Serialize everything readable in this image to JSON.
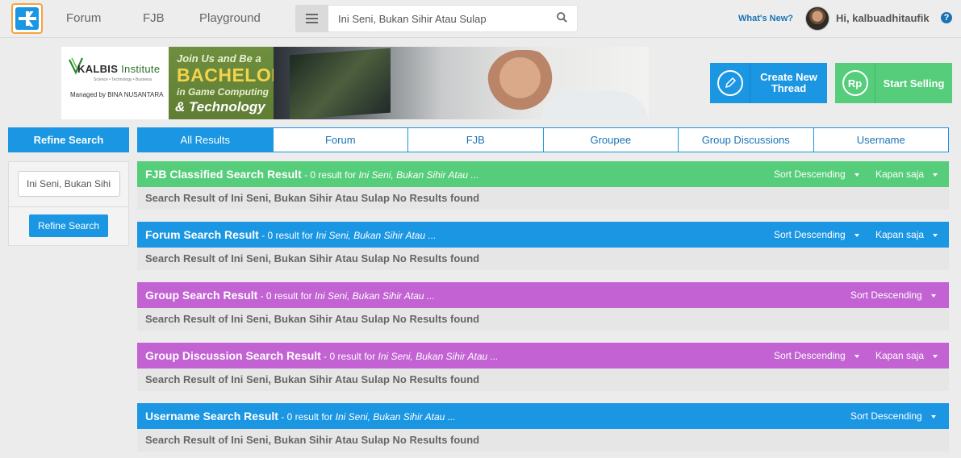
{
  "nav": {
    "links": [
      "Forum",
      "FJB",
      "Playground"
    ],
    "search_value": "Ini Seni, Bukan Sihir Atau Sulap",
    "whats_new": "What's New?",
    "greeting": "Hi, kalbuadhitaufik",
    "help": "?"
  },
  "banner": {
    "brand": "KALBIS",
    "brand_suffix": "Institute",
    "tagline": "Science • Technology • Business",
    "managed_by": "Managed by BINA NUSANTARA",
    "line1": "Join Us and Be a",
    "line2": "BACHELOR",
    "line3": "in Game Computing",
    "line4": "& Technology"
  },
  "actions": {
    "create_thread": "Create New Thread",
    "start_selling": "Start Selling",
    "rp_icon": "Rp"
  },
  "sidebar": {
    "header": "Refine Search",
    "input_value": "Ini Seni, Bukan Sihir Atau Sulap",
    "button": "Refine Search"
  },
  "tabs": [
    "All Results",
    "Forum",
    "FJB",
    "Groupee",
    "Group Discussions",
    "Username"
  ],
  "sections": [
    {
      "title": "FJB Classified Search Result",
      "count": " - 0 result for ",
      "query": "Ini Seni, Bukan Sihir Atau ...",
      "sort": "Sort Descending",
      "time": "Kapan saja",
      "body": "Search Result of Ini Seni, Bukan Sihir Atau Sulap No Results found",
      "color": "#55cd7a"
    },
    {
      "title": "Forum Search Result",
      "count": " - 0 result for ",
      "query": "Ini Seni, Bukan Sihir Atau ...",
      "sort": "Sort Descending",
      "time": "Kapan saja",
      "body": "Search Result of Ini Seni, Bukan Sihir Atau Sulap No Results found",
      "color": "#1a96e3"
    },
    {
      "title": "Group Search Result",
      "count": " - 0 result for ",
      "query": "Ini Seni, Bukan Sihir Atau ...",
      "sort": "Sort Descending",
      "body": "Search Result of Ini Seni, Bukan Sihir Atau Sulap No Results found",
      "color": "#c262d3"
    },
    {
      "title": "Group Discussion Search Result",
      "count": " - 0 result for ",
      "query": "Ini Seni, Bukan Sihir Atau ...",
      "sort": "Sort Descending",
      "time": "Kapan saja",
      "body": "Search Result of Ini Seni, Bukan Sihir Atau Sulap No Results found",
      "color": "#c262d3"
    },
    {
      "title": "Username Search Result",
      "count": " - 0 result for ",
      "query": "Ini Seni, Bukan Sihir Atau ...",
      "sort": "Sort Descending",
      "body": "Search Result of Ini Seni, Bukan Sihir Atau Sulap No Results found",
      "color": "#1a96e3"
    }
  ],
  "icons": {
    "logo": "kaskus-logo-icon",
    "menu": "hamburger-menu-icon",
    "search": "search-icon",
    "pencil": "pencil-icon",
    "caret": "caret-down-icon"
  }
}
